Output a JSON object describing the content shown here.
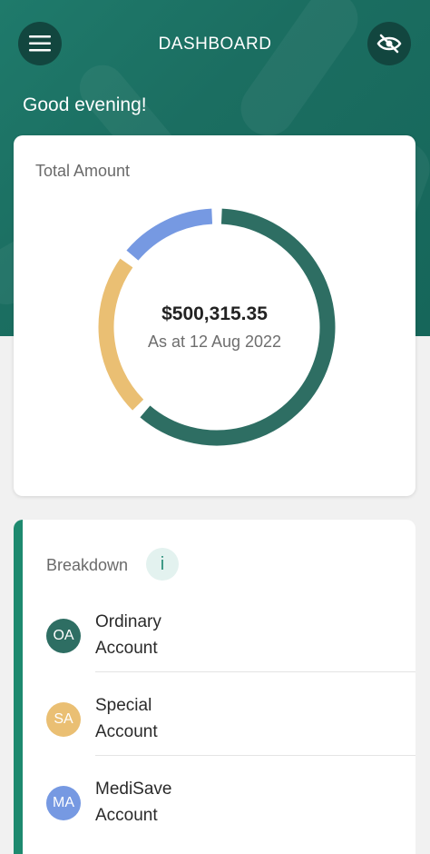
{
  "header": {
    "title": "DASHBOARD",
    "greeting": "Good evening!",
    "menu_icon": "hamburger-menu-icon",
    "hide_icon": "eye-off-icon"
  },
  "summary": {
    "label": "Total Amount",
    "total": "$500,315.35",
    "as_at": "As at 12 Aug 2022"
  },
  "chart_data": {
    "type": "pie",
    "style": "donut",
    "segments": [
      {
        "account": "Ordinary Account",
        "fraction": 0.6,
        "color": "#2e6e63"
      },
      {
        "account": "Special Account",
        "fraction": 0.22,
        "color": "#eabf73"
      },
      {
        "account": "MediSave Account",
        "fraction": 0.13,
        "color": "#7699e2"
      }
    ]
  },
  "breakdown": {
    "title": "Breakdown",
    "info_label": "i",
    "accounts": [
      {
        "code": "OA",
        "name_line1": "Ordinary",
        "name_line2": "Account",
        "color": "#2e6e63"
      },
      {
        "code": "SA",
        "name_line1": "Special",
        "name_line2": "Account",
        "color": "#eabf73"
      },
      {
        "code": "MA",
        "name_line1": "MediSave",
        "name_line2": "Account",
        "color": "#7699e2"
      }
    ]
  }
}
